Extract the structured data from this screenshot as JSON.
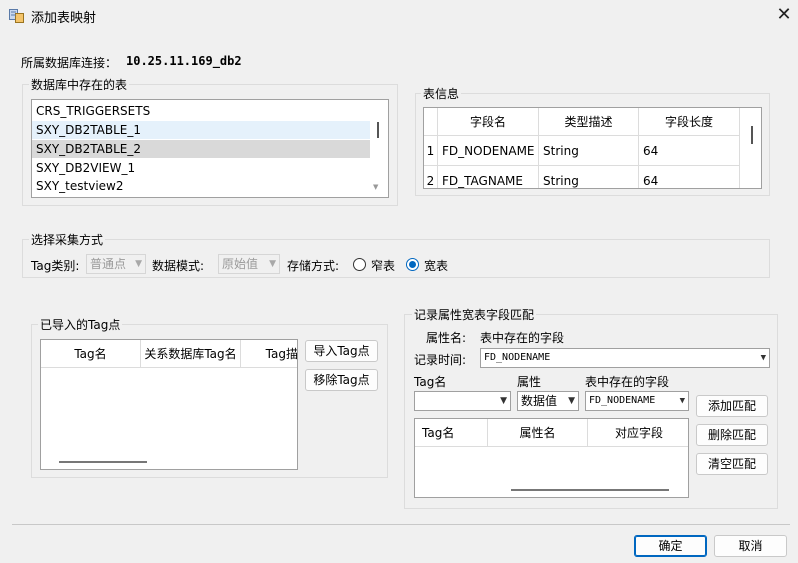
{
  "window": {
    "title": "添加表映射",
    "close_glyph": "✕"
  },
  "connection": {
    "label": "所属数据库连接：",
    "value": "10.25.11.169_db2"
  },
  "tables_group": {
    "legend": "数据库中存在的表",
    "items": [
      "CRS_TRIGGERSETS",
      "SXY_DB2TABLE_1",
      "SXY_DB2TABLE_2",
      "SXY_DB2VIEW_1",
      "SXY_testview2"
    ]
  },
  "table_info": {
    "legend": "表信息",
    "columns": [
      "字段名",
      "类型描述",
      "字段长度"
    ],
    "rows": [
      {
        "index": "1",
        "field": "FD_NODENAME",
        "type": "String",
        "length": "64"
      },
      {
        "index": "2",
        "field": "FD_TAGNAME",
        "type": "String",
        "length": "64"
      }
    ]
  },
  "collect_mode": {
    "legend": "选择采集方式",
    "tag_type_label": "Tag类别:",
    "tag_type_value": "普通点",
    "data_mode_label": "数据模式:",
    "data_mode_value": "原始值",
    "storage_label": "存储方式:",
    "storage_options": [
      "窄表",
      "宽表"
    ],
    "storage_selected": "宽表"
  },
  "imported_tags": {
    "legend": "已导入的Tag点",
    "columns": [
      "Tag名",
      "关系数据库Tag名",
      "Tag描"
    ],
    "import_button": "导入Tag点",
    "remove_button": "移除Tag点"
  },
  "wide_match": {
    "legend": "记录属性宽表字段匹配",
    "attr_label": "属性名:",
    "attr_value": "表中存在的字段",
    "record_time_label": "记录时间:",
    "record_time_value": "FD_NODENAME",
    "tag_label": "Tag名",
    "property_label": "属性",
    "field_label": "表中存在的字段",
    "tag_value": "",
    "property_value": "数据值",
    "field_value": "FD_NODENAME",
    "grid_columns": [
      "Tag名",
      "属性名",
      "对应字段"
    ],
    "add_button": "添加匹配",
    "delete_button": "删除匹配",
    "clear_button": "清空匹配"
  },
  "footer": {
    "ok": "确定",
    "cancel": "取消"
  }
}
